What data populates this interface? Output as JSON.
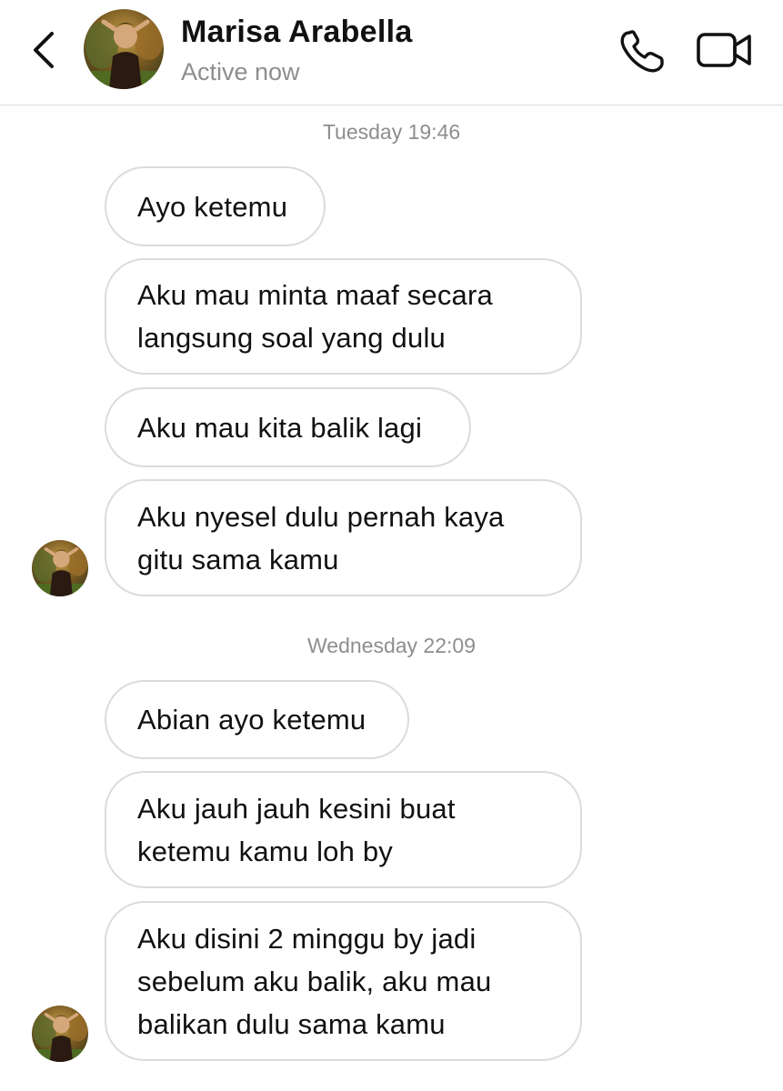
{
  "header": {
    "contact_name": "Marisa Arabella",
    "status": "Active now",
    "icons": [
      "chevron-left-icon",
      "phone-icon",
      "video-camera-icon"
    ]
  },
  "conversation": {
    "groups": [
      {
        "timestamp": "Tuesday 19:46",
        "messages": [
          "Ayo ketemu",
          "Aku mau minta maaf secara langsung soal yang dulu",
          "Aku mau kita balik lagi",
          "Aku nyesel dulu pernah kaya gitu sama kamu"
        ]
      },
      {
        "timestamp": "Wednesday 22:09",
        "messages": [
          "Abian ayo ketemu",
          "Aku jauh jauh kesini buat ketemu kamu loh by",
          "Aku disini 2 minggu by jadi sebelum aku balik, aku mau balikan dulu sama kamu"
        ]
      }
    ]
  },
  "colors": {
    "background": "#ffffff",
    "bubble_border": "#dbdbdb",
    "text": "#111111",
    "muted_text": "#8e8e8e",
    "divider": "#dcdcdc"
  }
}
